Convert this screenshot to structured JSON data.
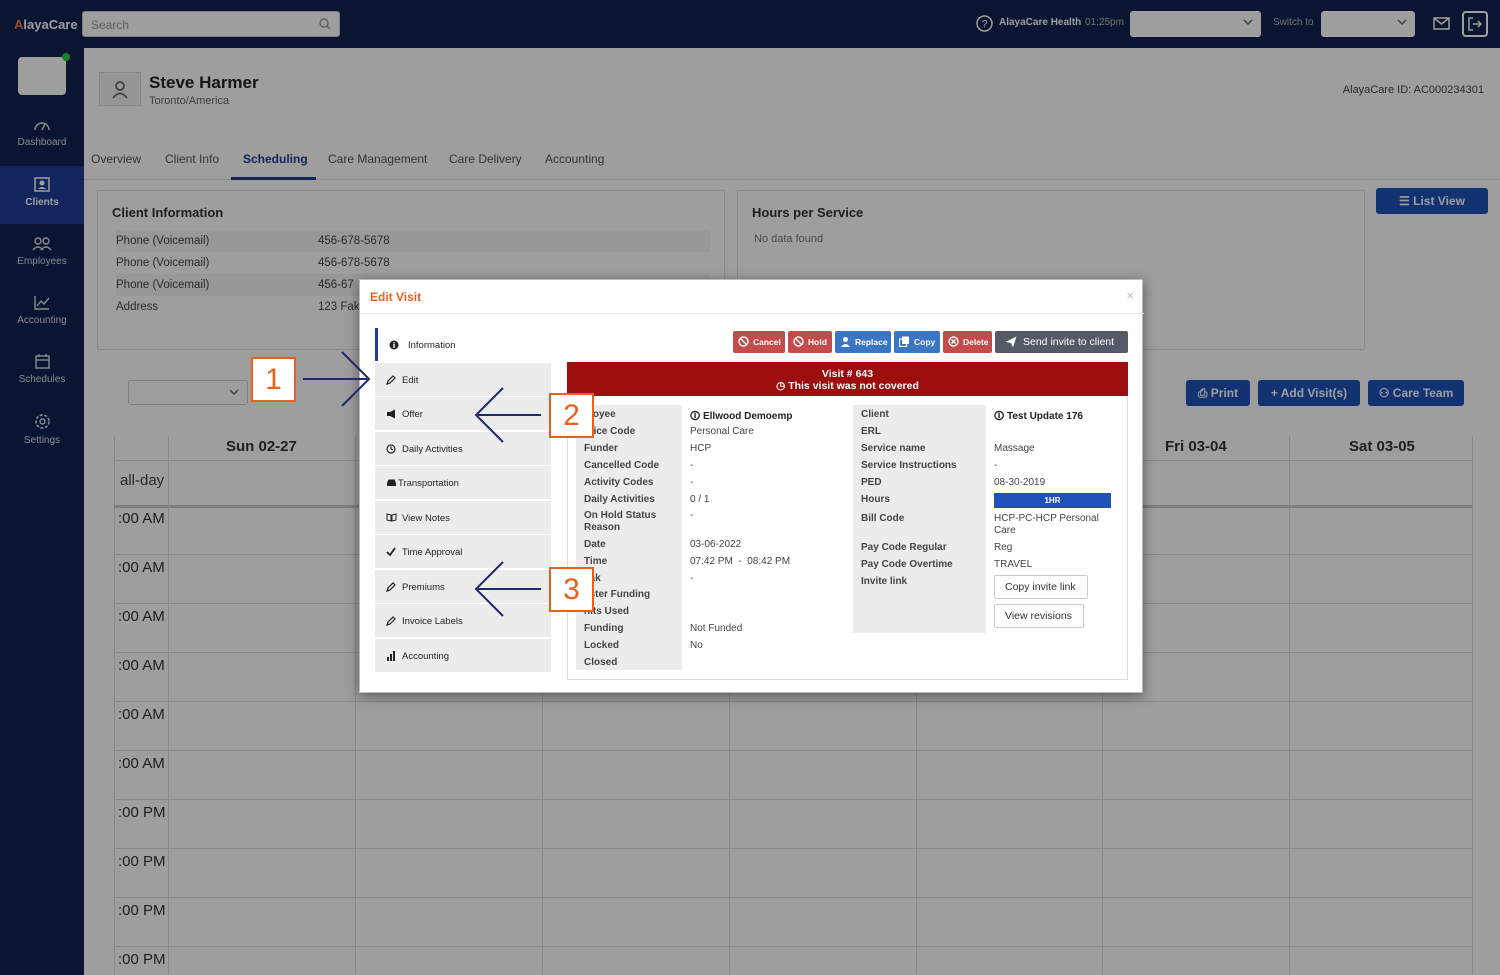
{
  "topbar": {
    "logo_prefix": "A",
    "logo_rest": "layaCare",
    "search_placeholder": "Search",
    "org_name": "AlayaCare Health",
    "time": "01:25pm",
    "switch_label": "Switch to"
  },
  "sidebar": {
    "items": [
      {
        "label": "Dashboard",
        "icon": "gauge-icon"
      },
      {
        "label": "Clients",
        "icon": "person-card-icon"
      },
      {
        "label": "Employees",
        "icon": "people-icon"
      },
      {
        "label": "Accounting",
        "icon": "chart-line-icon"
      },
      {
        "label": "Schedules",
        "icon": "calendar-icon"
      },
      {
        "label": "Settings",
        "icon": "gear-icon"
      }
    ]
  },
  "client": {
    "name": "Steve Harmer",
    "timezone": "Toronto/America",
    "id_label": "AlayaCare ID: AC000234301"
  },
  "tabs": [
    "Overview",
    "Client Info",
    "Scheduling",
    "Care Management",
    "Care Delivery",
    "Accounting"
  ],
  "client_info": {
    "title": "Client Information",
    "rows": [
      {
        "label": "Phone (Voicemail)",
        "value": "456-678-5678"
      },
      {
        "label": "Phone (Voicemail)",
        "value": "456-678-5678"
      },
      {
        "label": "Phone (Voicemail)",
        "value": "456-67"
      },
      {
        "label": "Address",
        "value": "123 Fak"
      }
    ]
  },
  "hours": {
    "title": "Hours per Service",
    "empty": "No data found"
  },
  "buttons": {
    "list_view": "List View",
    "print": "Print",
    "add_visits": "Add Visit(s)",
    "care_team": "Care Team"
  },
  "calendar": {
    "days": [
      "Sun 02-27",
      "Fri 03-04",
      "Sat 03-05"
    ],
    "allday": "all-day",
    "times": [
      ":00 AM",
      ":00 AM",
      ":00 AM",
      ":00 AM",
      ":00 AM",
      ":00 AM",
      ":00 PM",
      ":00 PM",
      ":00 PM",
      ":00 PM"
    ]
  },
  "modal": {
    "title": "Edit Visit",
    "close": "×",
    "side_tabs": [
      "Information",
      "Edit",
      "Offer",
      "Daily Activities",
      "Transportation",
      "View Notes",
      "Time Approval",
      "Premiums",
      "Invoice Labels",
      "Accounting"
    ],
    "actions": {
      "cancel": "Cancel",
      "hold": "Hold",
      "replace": "Replace",
      "copy": "Copy",
      "delete": "Delete",
      "send_invite": "Send invite to client"
    },
    "banner_line1": "Visit # 643",
    "banner_line2": "This visit was not covered",
    "left_labels": [
      "ployee",
      "rvice Code",
      "Funder",
      "Cancelled Code",
      "Activity Codes",
      "Daily Activities",
      "On Hold Status",
      "Reason",
      "Date",
      "Time",
      "eak",
      "aster Funding",
      "nits Used",
      "Funding",
      "Locked",
      "Closed"
    ],
    "left_values": {
      "employee": "Ellwood Demoemp",
      "service_code": "Personal Care",
      "funder": "HCP",
      "cancelled_code": "-",
      "activity_codes": "-",
      "daily_activities": "0 / 1",
      "on_hold_status": "-",
      "date": "03-06-2022",
      "time": "07:42 PM  -  08:42 PM",
      "break": "-",
      "funding": "Not Funded",
      "locked": "No"
    },
    "right_labels": [
      "Client",
      "ERL",
      "Service name",
      "Service Instructions",
      "PED",
      "Hours",
      "Bill Code",
      "Pay Code Regular",
      "Pay Code Overtime",
      "Invite link"
    ],
    "right_values": {
      "client": "Test Update 176",
      "service_name": "Massage",
      "service_instructions": "-",
      "ped": "08-30-2019",
      "hours": "1HR",
      "bill_code_1": "HCP-PC-HCP Personal",
      "bill_code_2": "Care",
      "pay_regular": "Reg",
      "pay_overtime": "TRAVEL"
    },
    "copy_invite": "Copy invite link",
    "view_revisions": "View revisions"
  },
  "callouts": [
    "1",
    "2",
    "3"
  ],
  "colors": {
    "navy": "#13234f",
    "accent": "#1f3d96",
    "orange": "#e8601c",
    "banner": "#9c0e0e",
    "blue_btn": "#1f52b8"
  }
}
